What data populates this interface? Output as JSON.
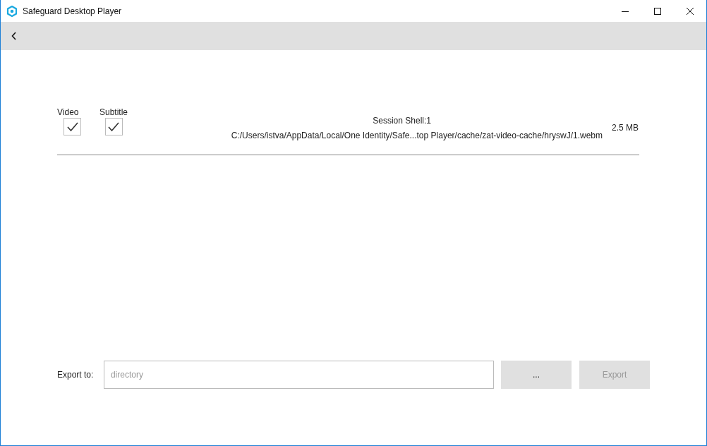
{
  "window": {
    "title": "Safeguard Desktop Player"
  },
  "checkboxes": [
    {
      "label": "Video",
      "checked": true
    },
    {
      "label": "Subtitle",
      "checked": true
    }
  ],
  "file": {
    "session": "Session Shell:1",
    "path": "C:/Users/istva/AppData/Local/One Identity/Safe...top Player/cache/zat-video-cache/hryswJ/1.webm",
    "size": "2.5 MB"
  },
  "export": {
    "label": "Export to:",
    "placeholder": "directory",
    "buttons": [
      {
        "label": "...",
        "disabled": false
      },
      {
        "label": "Export",
        "disabled": true
      }
    ]
  }
}
